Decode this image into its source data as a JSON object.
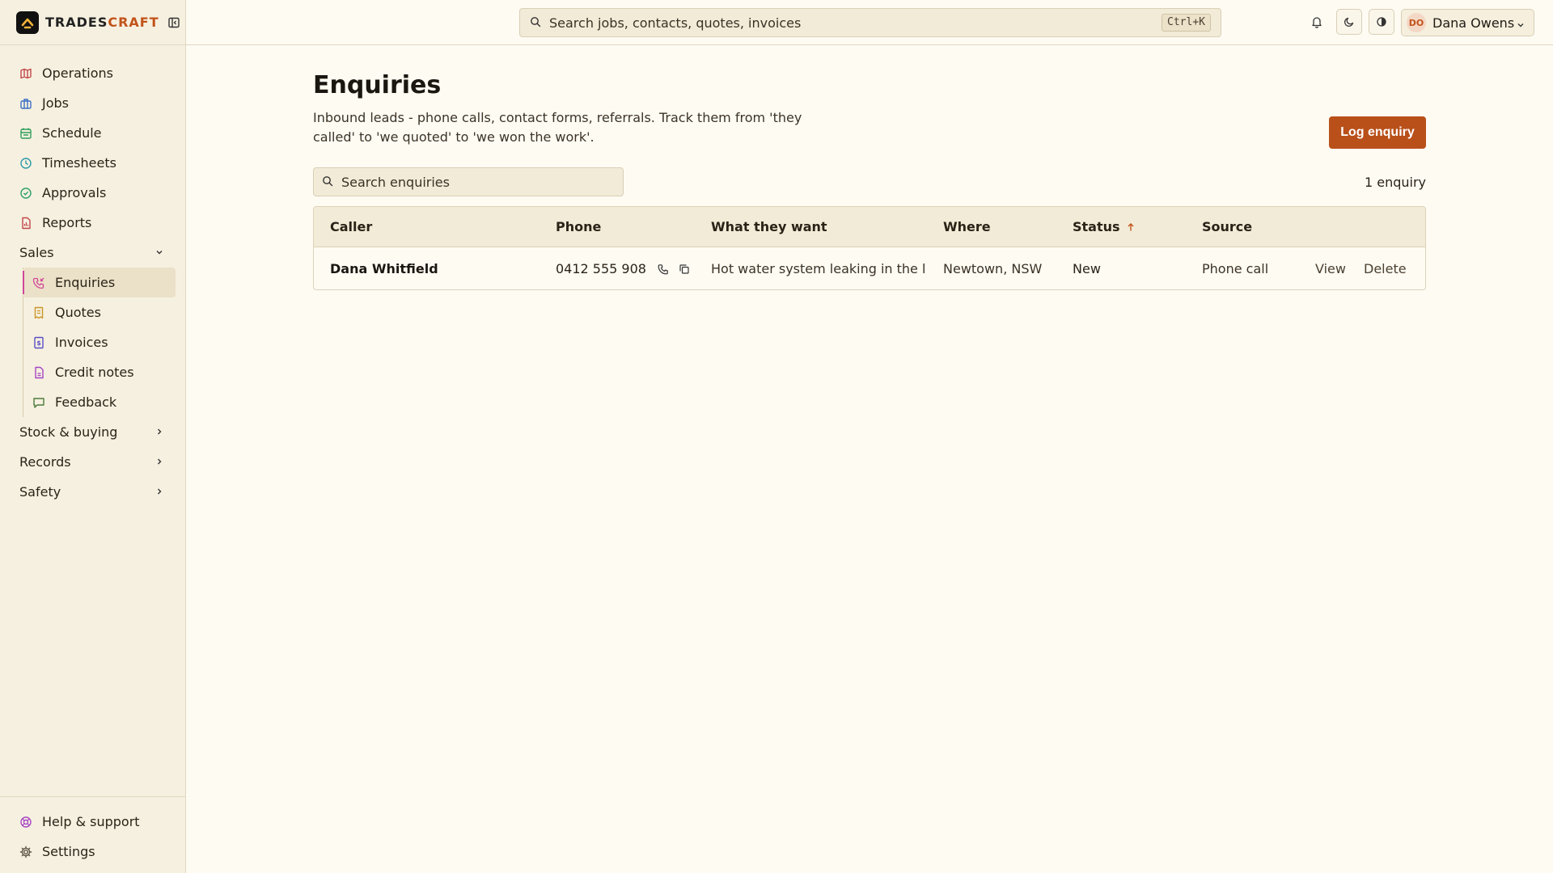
{
  "brand": {
    "name_part1": "TRADES",
    "name_part2": "CRAFT"
  },
  "nav": {
    "items": [
      {
        "label": "Operations",
        "icon": "map-icon",
        "color": "#c2474a"
      },
      {
        "label": "Jobs",
        "icon": "briefcase-icon",
        "color": "#3b6fc4"
      },
      {
        "label": "Schedule",
        "icon": "calendar-icon",
        "color": "#2e9e5b"
      },
      {
        "label": "Timesheets",
        "icon": "clock-icon",
        "color": "#2a9aa8"
      },
      {
        "label": "Approvals",
        "icon": "check-circle-icon",
        "color": "#2e9e6b"
      },
      {
        "label": "Reports",
        "icon": "file-chart-icon",
        "color": "#c2474a"
      }
    ],
    "sales_group": "Sales",
    "sales_items": [
      {
        "label": "Enquiries",
        "icon": "phone-incoming-icon",
        "color": "#d1479a",
        "active": true
      },
      {
        "label": "Quotes",
        "icon": "receipt-icon",
        "color": "#c9972a"
      },
      {
        "label": "Invoices",
        "icon": "invoice-icon",
        "color": "#5a4fc4"
      },
      {
        "label": "Credit notes",
        "icon": "file-icon",
        "color": "#a646c4"
      },
      {
        "label": "Feedback",
        "icon": "message-square-icon",
        "color": "#4a7a3a"
      }
    ],
    "groups": [
      "Stock & buying",
      "Records",
      "Safety"
    ],
    "bottom": [
      {
        "label": "Help & support",
        "icon": "lifebuoy-icon",
        "color": "#a646c4"
      },
      {
        "label": "Settings",
        "icon": "gear-icon",
        "color": "#5a5040"
      }
    ]
  },
  "topbar": {
    "search_placeholder": "Search jobs, contacts, quotes, invoices",
    "shortcut": "Ctrl+K",
    "user_initials": "DO",
    "user_name": "Dana Owens"
  },
  "page": {
    "title": "Enquiries",
    "description": "Inbound leads - phone calls, contact forms, referrals. Track them from 'they called' to 'we quoted' to 'we won the work'.",
    "log_button": "Log enquiry",
    "search_placeholder": "Search enquiries",
    "count": "1 enquiry"
  },
  "table": {
    "headers": {
      "caller": "Caller",
      "phone": "Phone",
      "want": "What they want",
      "where": "Where",
      "status": "Status",
      "source": "Source"
    },
    "rows": [
      {
        "caller": "Dana Whitfield",
        "phone": "0412 555 908",
        "want": "Hot water system leaking in the laundry",
        "where": "Newtown, NSW",
        "status": "New",
        "source": "Phone call",
        "view": "View",
        "delete": "Delete"
      }
    ]
  },
  "colors": {
    "accent": "#b9501a",
    "active_marker": "#d1479a"
  }
}
